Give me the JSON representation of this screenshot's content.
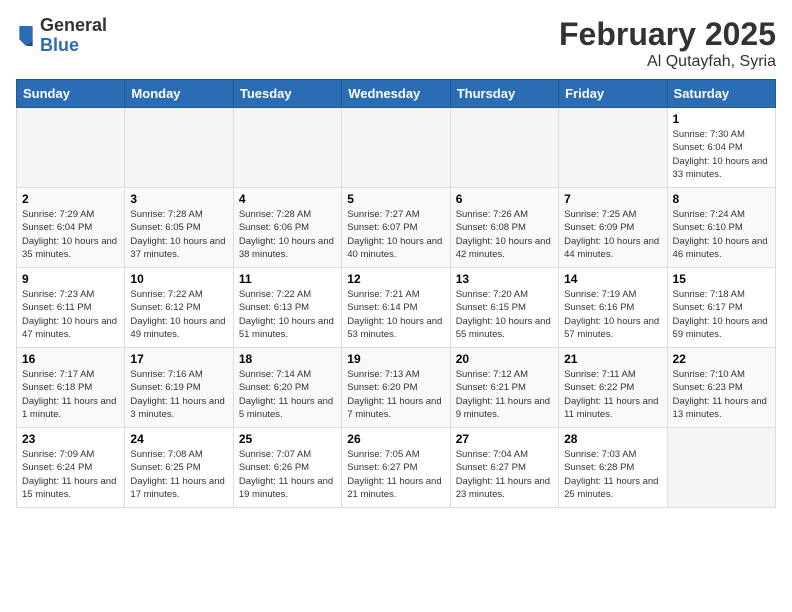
{
  "logo": {
    "general": "General",
    "blue": "Blue"
  },
  "header": {
    "month": "February 2025",
    "location": "Al Qutayfah, Syria"
  },
  "weekdays": [
    "Sunday",
    "Monday",
    "Tuesday",
    "Wednesday",
    "Thursday",
    "Friday",
    "Saturday"
  ],
  "weeks": [
    [
      {
        "day": "",
        "info": ""
      },
      {
        "day": "",
        "info": ""
      },
      {
        "day": "",
        "info": ""
      },
      {
        "day": "",
        "info": ""
      },
      {
        "day": "",
        "info": ""
      },
      {
        "day": "",
        "info": ""
      },
      {
        "day": "1",
        "info": "Sunrise: 7:30 AM\nSunset: 6:04 PM\nDaylight: 10 hours and 33 minutes."
      }
    ],
    [
      {
        "day": "2",
        "info": "Sunrise: 7:29 AM\nSunset: 6:04 PM\nDaylight: 10 hours and 35 minutes."
      },
      {
        "day": "3",
        "info": "Sunrise: 7:28 AM\nSunset: 6:05 PM\nDaylight: 10 hours and 37 minutes."
      },
      {
        "day": "4",
        "info": "Sunrise: 7:28 AM\nSunset: 6:06 PM\nDaylight: 10 hours and 38 minutes."
      },
      {
        "day": "5",
        "info": "Sunrise: 7:27 AM\nSunset: 6:07 PM\nDaylight: 10 hours and 40 minutes."
      },
      {
        "day": "6",
        "info": "Sunrise: 7:26 AM\nSunset: 6:08 PM\nDaylight: 10 hours and 42 minutes."
      },
      {
        "day": "7",
        "info": "Sunrise: 7:25 AM\nSunset: 6:09 PM\nDaylight: 10 hours and 44 minutes."
      },
      {
        "day": "8",
        "info": "Sunrise: 7:24 AM\nSunset: 6:10 PM\nDaylight: 10 hours and 46 minutes."
      }
    ],
    [
      {
        "day": "9",
        "info": "Sunrise: 7:23 AM\nSunset: 6:11 PM\nDaylight: 10 hours and 47 minutes."
      },
      {
        "day": "10",
        "info": "Sunrise: 7:22 AM\nSunset: 6:12 PM\nDaylight: 10 hours and 49 minutes."
      },
      {
        "day": "11",
        "info": "Sunrise: 7:22 AM\nSunset: 6:13 PM\nDaylight: 10 hours and 51 minutes."
      },
      {
        "day": "12",
        "info": "Sunrise: 7:21 AM\nSunset: 6:14 PM\nDaylight: 10 hours and 53 minutes."
      },
      {
        "day": "13",
        "info": "Sunrise: 7:20 AM\nSunset: 6:15 PM\nDaylight: 10 hours and 55 minutes."
      },
      {
        "day": "14",
        "info": "Sunrise: 7:19 AM\nSunset: 6:16 PM\nDaylight: 10 hours and 57 minutes."
      },
      {
        "day": "15",
        "info": "Sunrise: 7:18 AM\nSunset: 6:17 PM\nDaylight: 10 hours and 59 minutes."
      }
    ],
    [
      {
        "day": "16",
        "info": "Sunrise: 7:17 AM\nSunset: 6:18 PM\nDaylight: 11 hours and 1 minute."
      },
      {
        "day": "17",
        "info": "Sunrise: 7:16 AM\nSunset: 6:19 PM\nDaylight: 11 hours and 3 minutes."
      },
      {
        "day": "18",
        "info": "Sunrise: 7:14 AM\nSunset: 6:20 PM\nDaylight: 11 hours and 5 minutes."
      },
      {
        "day": "19",
        "info": "Sunrise: 7:13 AM\nSunset: 6:20 PM\nDaylight: 11 hours and 7 minutes."
      },
      {
        "day": "20",
        "info": "Sunrise: 7:12 AM\nSunset: 6:21 PM\nDaylight: 11 hours and 9 minutes."
      },
      {
        "day": "21",
        "info": "Sunrise: 7:11 AM\nSunset: 6:22 PM\nDaylight: 11 hours and 11 minutes."
      },
      {
        "day": "22",
        "info": "Sunrise: 7:10 AM\nSunset: 6:23 PM\nDaylight: 11 hours and 13 minutes."
      }
    ],
    [
      {
        "day": "23",
        "info": "Sunrise: 7:09 AM\nSunset: 6:24 PM\nDaylight: 11 hours and 15 minutes."
      },
      {
        "day": "24",
        "info": "Sunrise: 7:08 AM\nSunset: 6:25 PM\nDaylight: 11 hours and 17 minutes."
      },
      {
        "day": "25",
        "info": "Sunrise: 7:07 AM\nSunset: 6:26 PM\nDaylight: 11 hours and 19 minutes."
      },
      {
        "day": "26",
        "info": "Sunrise: 7:05 AM\nSunset: 6:27 PM\nDaylight: 11 hours and 21 minutes."
      },
      {
        "day": "27",
        "info": "Sunrise: 7:04 AM\nSunset: 6:27 PM\nDaylight: 11 hours and 23 minutes."
      },
      {
        "day": "28",
        "info": "Sunrise: 7:03 AM\nSunset: 6:28 PM\nDaylight: 11 hours and 25 minutes."
      },
      {
        "day": "",
        "info": ""
      }
    ]
  ]
}
